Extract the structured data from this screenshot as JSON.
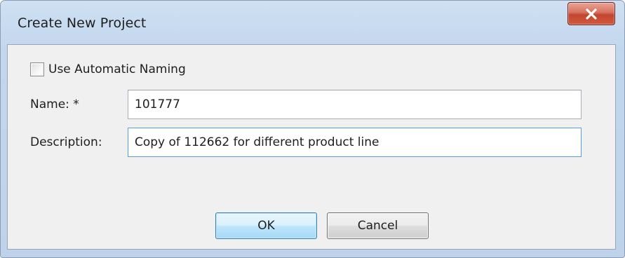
{
  "window": {
    "title": "Create New Project",
    "close_icon": "close-icon"
  },
  "form": {
    "auto_naming": {
      "label": "Use Automatic Naming",
      "checked": false
    },
    "name": {
      "label": "Name:  *",
      "value": "101777"
    },
    "description": {
      "label": "Description:",
      "value": "Copy of 112662 for different product line"
    }
  },
  "buttons": {
    "ok_label": "OK",
    "cancel_label": "Cancel"
  },
  "colors": {
    "title_bar": "#c2d7ee",
    "client_area": "#f0f0f0",
    "close_button": "#c2452f",
    "focus_border": "#569de5",
    "default_button_border": "#3c7fb1"
  }
}
